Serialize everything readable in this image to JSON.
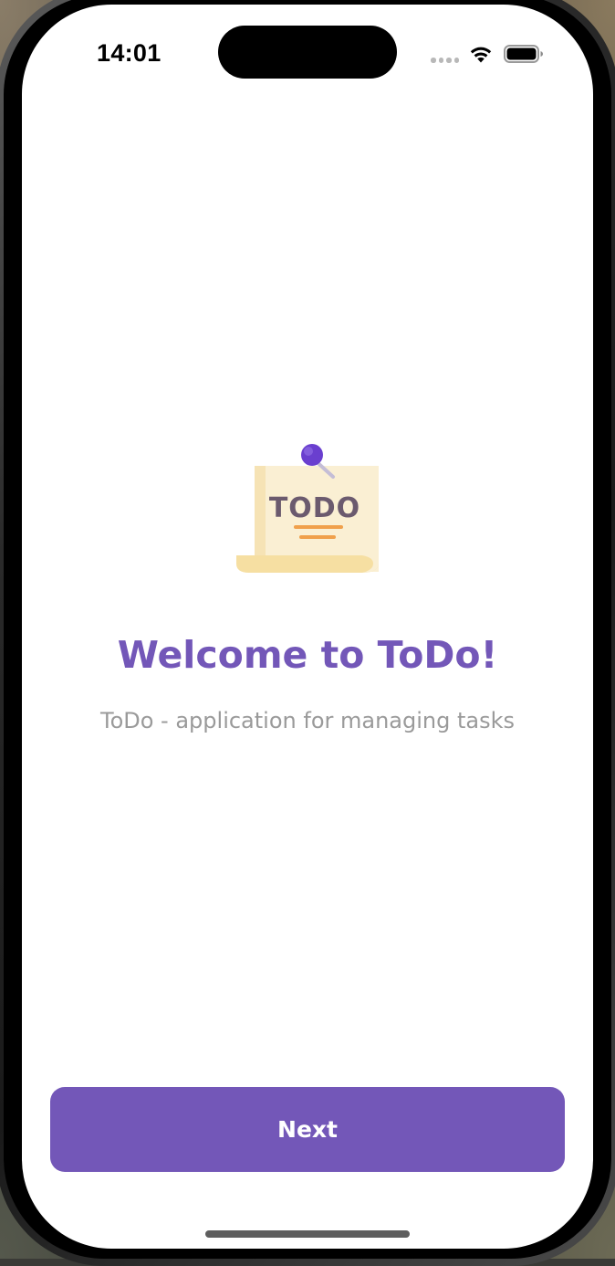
{
  "status_bar": {
    "time": "14:01",
    "signal_icon": "signal-dots-icon",
    "wifi_icon": "wifi-icon",
    "battery_icon": "battery-icon"
  },
  "illustration": {
    "icon": "todo-note-icon",
    "text": "TODO",
    "colors": {
      "paper": "#faefd3",
      "paper_roll": "#f6dfa2",
      "pin_head": "#6a3fcf",
      "pin_needle": "#c4bdd6",
      "text": "#6b5a6e",
      "lines": "#f0a04b"
    }
  },
  "main": {
    "title": "Welcome to ToDo!",
    "subtitle": "ToDo - application for managing tasks"
  },
  "actions": {
    "next_label": "Next"
  },
  "colors": {
    "accent": "#7357b8",
    "subtitle": "#9a9a9a",
    "background": "#ffffff"
  }
}
